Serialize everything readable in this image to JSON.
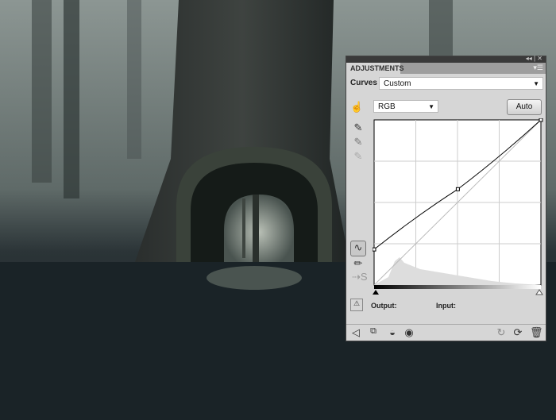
{
  "panel": {
    "tab": "ADJUSTMENTS",
    "preset_label": "Curves",
    "preset_value": "Custom",
    "channel": "RGB",
    "auto_button": "Auto",
    "output_label": "Output:",
    "input_label": "Input:"
  },
  "curve": {
    "points": [
      [
        0,
        55
      ],
      [
        128,
        148
      ],
      [
        255,
        255
      ]
    ]
  },
  "colors": {
    "panel": "#d6d6d6",
    "accent": "#000000"
  }
}
